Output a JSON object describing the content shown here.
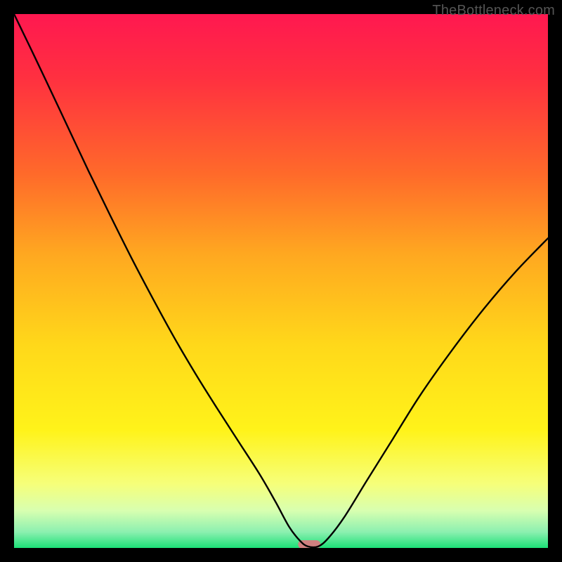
{
  "watermark": "TheBottleneck.com",
  "chart_data": {
    "type": "line",
    "title": "",
    "xlabel": "",
    "ylabel": "",
    "xlim": [
      0,
      100
    ],
    "ylim": [
      0,
      100
    ],
    "grid": false,
    "legend": false,
    "background": {
      "type": "vertical-gradient",
      "stops": [
        {
          "pos": 0.0,
          "color": "#ff1850"
        },
        {
          "pos": 0.12,
          "color": "#ff3040"
        },
        {
          "pos": 0.3,
          "color": "#ff6a2a"
        },
        {
          "pos": 0.45,
          "color": "#ffa820"
        },
        {
          "pos": 0.62,
          "color": "#ffd81a"
        },
        {
          "pos": 0.78,
          "color": "#fff31a"
        },
        {
          "pos": 0.88,
          "color": "#f6ff7a"
        },
        {
          "pos": 0.93,
          "color": "#d8ffb0"
        },
        {
          "pos": 0.97,
          "color": "#8cf0b0"
        },
        {
          "pos": 1.0,
          "color": "#1ce077"
        }
      ]
    },
    "series": [
      {
        "name": "bottleneck-curve",
        "color": "#000000",
        "x": [
          0.0,
          3.0,
          6.0,
          10.0,
          14.0,
          18.0,
          22.0,
          26.0,
          30.0,
          34.0,
          38.0,
          42.0,
          46.0,
          49.0,
          51.5,
          53.5,
          55.0,
          57.0,
          59.0,
          62.0,
          66.0,
          71.0,
          76.0,
          82.0,
          88.0,
          94.0,
          100.0
        ],
        "y": [
          100.0,
          93.8,
          87.5,
          79.0,
          70.5,
          62.3,
          54.3,
          46.7,
          39.4,
          32.6,
          26.2,
          20.0,
          13.8,
          8.6,
          4.0,
          1.4,
          0.3,
          0.3,
          2.0,
          6.0,
          12.5,
          20.5,
          28.5,
          37.0,
          44.8,
          51.8,
          58.0
        ]
      }
    ],
    "marker": {
      "name": "bottleneck-marker",
      "x_center": 55.3,
      "width": 4.2,
      "color": "#d08080"
    }
  }
}
